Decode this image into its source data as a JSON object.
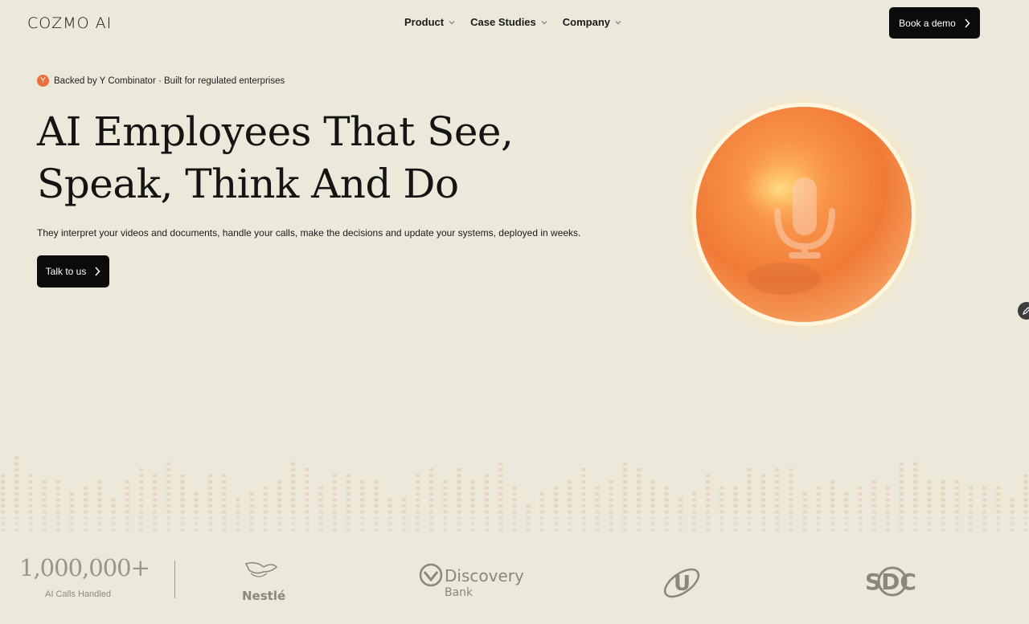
{
  "nav": {
    "logo": "COZMO AI",
    "menu": [
      {
        "label": "Product"
      },
      {
        "label": "Case Studies"
      },
      {
        "label": "Company"
      }
    ],
    "cta": "Book a demo"
  },
  "hero": {
    "badge_letter": "Y",
    "badge_text": "Backed by Y Combinator · Built for regulated enterprises",
    "headline_line1": "AI Employees That See,",
    "headline_line2": "Speak, Think And Do",
    "subhead": "They interpret your videos and documents, handle your calls, make the decisions and update your systems, deployed in weeks.",
    "cta": "Talk to us",
    "orb_icon": "microphone-icon"
  },
  "stats": {
    "value": "1,000,000+",
    "label": "AI Calls Handled"
  },
  "logos": [
    {
      "name": "nestle-logo",
      "text": "Nestlé"
    },
    {
      "name": "discovery-bank-logo",
      "text": "Discovery",
      "sub": "Bank"
    },
    {
      "name": "u-logo",
      "text": "U"
    },
    {
      "name": "sdc-logo",
      "text": "SDC"
    }
  ],
  "colors": {
    "background": "#ece8da",
    "button": "#0b0b0b",
    "orb": "#f07f3c",
    "badge": "#e8703a"
  }
}
